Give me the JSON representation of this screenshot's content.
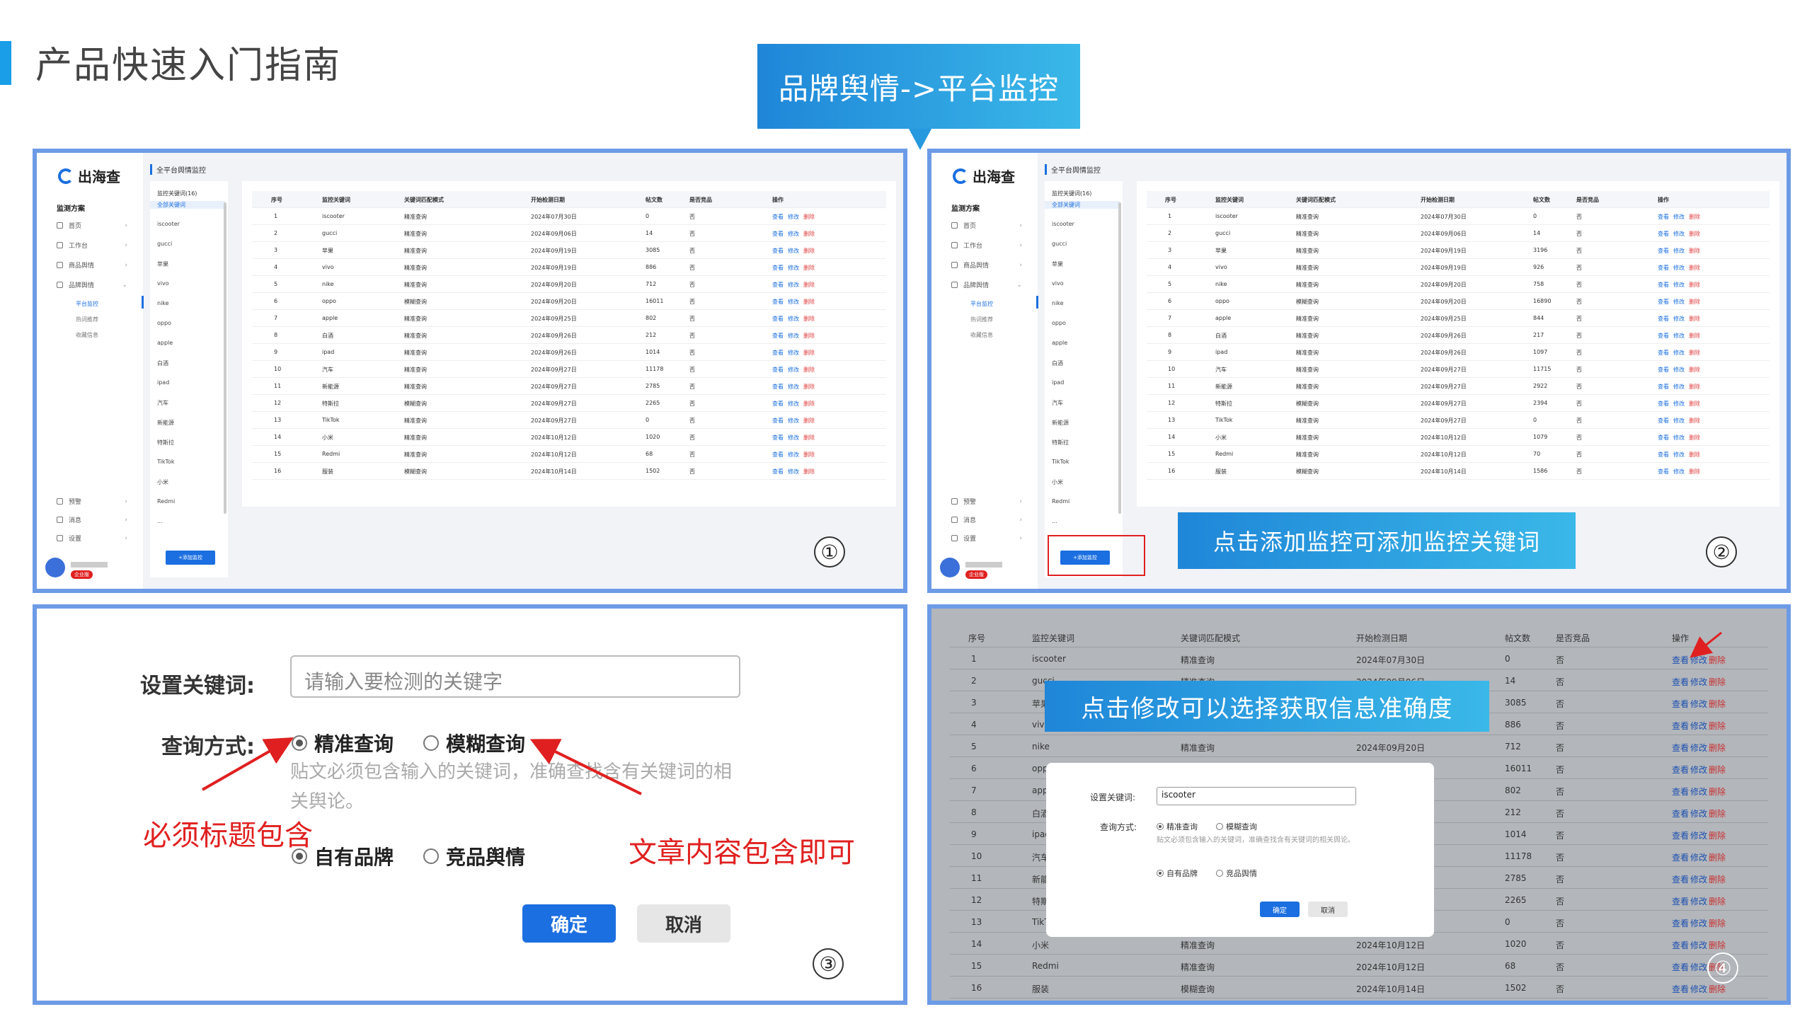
{
  "page": {
    "title": "产品快速入门指南",
    "callout": "品牌舆情->平台监控"
  },
  "app": {
    "logo": "出海查",
    "sidebar_header": "监测方案",
    "nav": [
      {
        "label": "首页"
      },
      {
        "label": "工作台"
      },
      {
        "label": "商品舆情"
      },
      {
        "label": "品牌舆情"
      }
    ],
    "sub_nav": [
      {
        "label": "平台监控"
      },
      {
        "label": "热词推荐"
      },
      {
        "label": "收藏信息"
      }
    ],
    "bottom_nav": [
      {
        "label": "预警"
      },
      {
        "label": "消息"
      },
      {
        "label": "设置"
      }
    ],
    "user_badge": "企业版",
    "breadcrumb": "全平台舆情监控",
    "keyword_header": "监控关键词(16)",
    "keywords": [
      "全部关键词",
      "iscooter",
      "gucci",
      "苹果",
      "vivo",
      "nike",
      "oppo",
      "apple",
      "白酒",
      "ipad",
      "汽车",
      "新能源",
      "特斯拉",
      "TikTok",
      "小米",
      "Redmi"
    ],
    "keyword_more": "...",
    "add_button": "+添加监控"
  },
  "table": {
    "headers": [
      "序号",
      "监控关键词",
      "关键词匹配模式",
      "开始检测日期",
      "帖文数",
      "是否竞品",
      "操作"
    ],
    "ops": {
      "view": "查看",
      "edit": "修改",
      "del": "删除"
    },
    "rows": [
      {
        "n": "1",
        "kw": "iscooter",
        "mode": "精准查询",
        "date": "2024年07月30日",
        "posts": "0",
        "posts2": "0",
        "comp": "否"
      },
      {
        "n": "2",
        "kw": "gucci",
        "mode": "精准查询",
        "date": "2024年09月06日",
        "posts": "14",
        "posts2": "14",
        "comp": "否"
      },
      {
        "n": "3",
        "kw": "苹果",
        "mode": "精准查询",
        "date": "2024年09月19日",
        "posts": "3085",
        "posts2": "3196",
        "comp": "否"
      },
      {
        "n": "4",
        "kw": "vivo",
        "mode": "精准查询",
        "date": "2024年09月19日",
        "posts": "886",
        "posts2": "926",
        "comp": "否"
      },
      {
        "n": "5",
        "kw": "nike",
        "mode": "精准查询",
        "date": "2024年09月20日",
        "posts": "712",
        "posts2": "758",
        "comp": "否"
      },
      {
        "n": "6",
        "kw": "oppo",
        "mode": "模糊查询",
        "date": "2024年09月20日",
        "posts": "16011",
        "posts2": "16890",
        "comp": "否"
      },
      {
        "n": "7",
        "kw": "apple",
        "mode": "精准查询",
        "date": "2024年09月25日",
        "posts": "802",
        "posts2": "844",
        "comp": "否"
      },
      {
        "n": "8",
        "kw": "白酒",
        "mode": "精准查询",
        "date": "2024年09月26日",
        "posts": "212",
        "posts2": "217",
        "comp": "否"
      },
      {
        "n": "9",
        "kw": "ipad",
        "mode": "精准查询",
        "date": "2024年09月26日",
        "posts": "1014",
        "posts2": "1097",
        "comp": "否"
      },
      {
        "n": "10",
        "kw": "汽车",
        "mode": "精准查询",
        "date": "2024年09月27日",
        "posts": "11178",
        "posts2": "11715",
        "comp": "否"
      },
      {
        "n": "11",
        "kw": "新能源",
        "mode": "精准查询",
        "date": "2024年09月27日",
        "posts": "2785",
        "posts2": "2922",
        "comp": "否"
      },
      {
        "n": "12",
        "kw": "特斯拉",
        "mode": "模糊查询",
        "date": "2024年09月27日",
        "posts": "2265",
        "posts2": "2394",
        "comp": "否"
      },
      {
        "n": "13",
        "kw": "TikTok",
        "mode": "精准查询",
        "date": "2024年09月27日",
        "posts": "0",
        "posts2": "0",
        "comp": "否"
      },
      {
        "n": "14",
        "kw": "小米",
        "mode": "精准查询",
        "date": "2024年10月12日",
        "posts": "1020",
        "posts2": "1079",
        "comp": "否"
      },
      {
        "n": "15",
        "kw": "Redmi",
        "mode": "精准查询",
        "date": "2024年10月12日",
        "posts": "68",
        "posts2": "70",
        "comp": "否"
      },
      {
        "n": "16",
        "kw": "服装",
        "mode": "模糊查询",
        "date": "2024年10月14日",
        "posts": "1502",
        "posts2": "1586",
        "comp": "否"
      }
    ]
  },
  "markers": [
    "①",
    "②",
    "③",
    "④"
  ],
  "panel2": {
    "banner": "点击添加监控可添加监控关键词"
  },
  "panel3": {
    "keyword_label": "设置关键词:",
    "keyword_placeholder": "请输入要检测的关键字",
    "query_label": "查询方式:",
    "exact": "精准查询",
    "fuzzy": "模糊查询",
    "hint": "贴文必须包含输入的关键词，准确查找含有关键词的相关舆论。",
    "own_brand": "自有品牌",
    "competitor": "竞品舆情",
    "note_exact": "必须标题包含",
    "note_fuzzy": "文章内容包含即可",
    "ok": "确定",
    "cancel": "取消"
  },
  "panel4": {
    "banner": "点击修改可以选择获取信息准确度",
    "keyword_value": "iscooter"
  },
  "colors": {
    "accent": "#1b6fe0",
    "frame": "#6d9be6",
    "danger": "#e02020"
  }
}
